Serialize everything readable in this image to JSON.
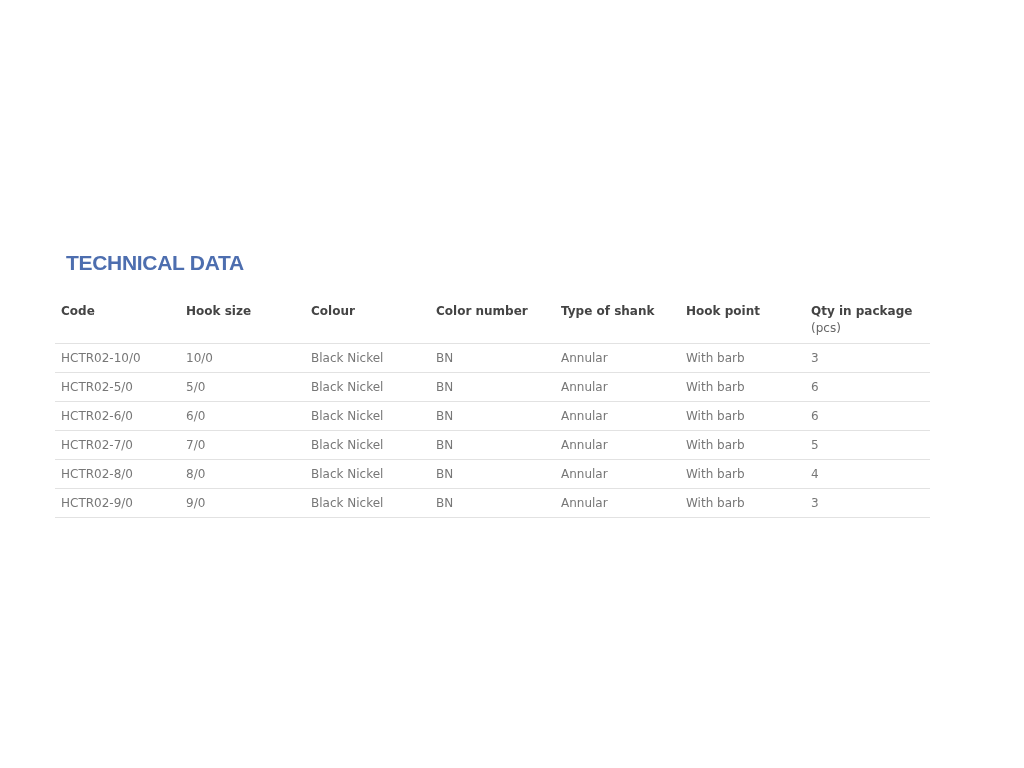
{
  "title": "TECHNICAL DATA",
  "table": {
    "columns": [
      {
        "label": "Code"
      },
      {
        "label": "Hook size"
      },
      {
        "label": "Colour"
      },
      {
        "label": "Color number"
      },
      {
        "label": "Type of shank"
      },
      {
        "label": "Hook point"
      },
      {
        "label": "Qty in package",
        "unit": "(pcs)"
      }
    ],
    "rows": [
      [
        "HCTR02-10/0",
        "10/0",
        "Black Nickel",
        "BN",
        "Annular",
        "With barb",
        "3"
      ],
      [
        "HCTR02-5/0",
        "5/0",
        "Black Nickel",
        "BN",
        "Annular",
        "With barb",
        "6"
      ],
      [
        "HCTR02-6/0",
        "6/0",
        "Black Nickel",
        "BN",
        "Annular",
        "With barb",
        "6"
      ],
      [
        "HCTR02-7/0",
        "7/0",
        "Black Nickel",
        "BN",
        "Annular",
        "With barb",
        "5"
      ],
      [
        "HCTR02-8/0",
        "8/0",
        "Black Nickel",
        "BN",
        "Annular",
        "With barb",
        "4"
      ],
      [
        "HCTR02-9/0",
        "9/0",
        "Black Nickel",
        "BN",
        "Annular",
        "With barb",
        "3"
      ]
    ]
  }
}
